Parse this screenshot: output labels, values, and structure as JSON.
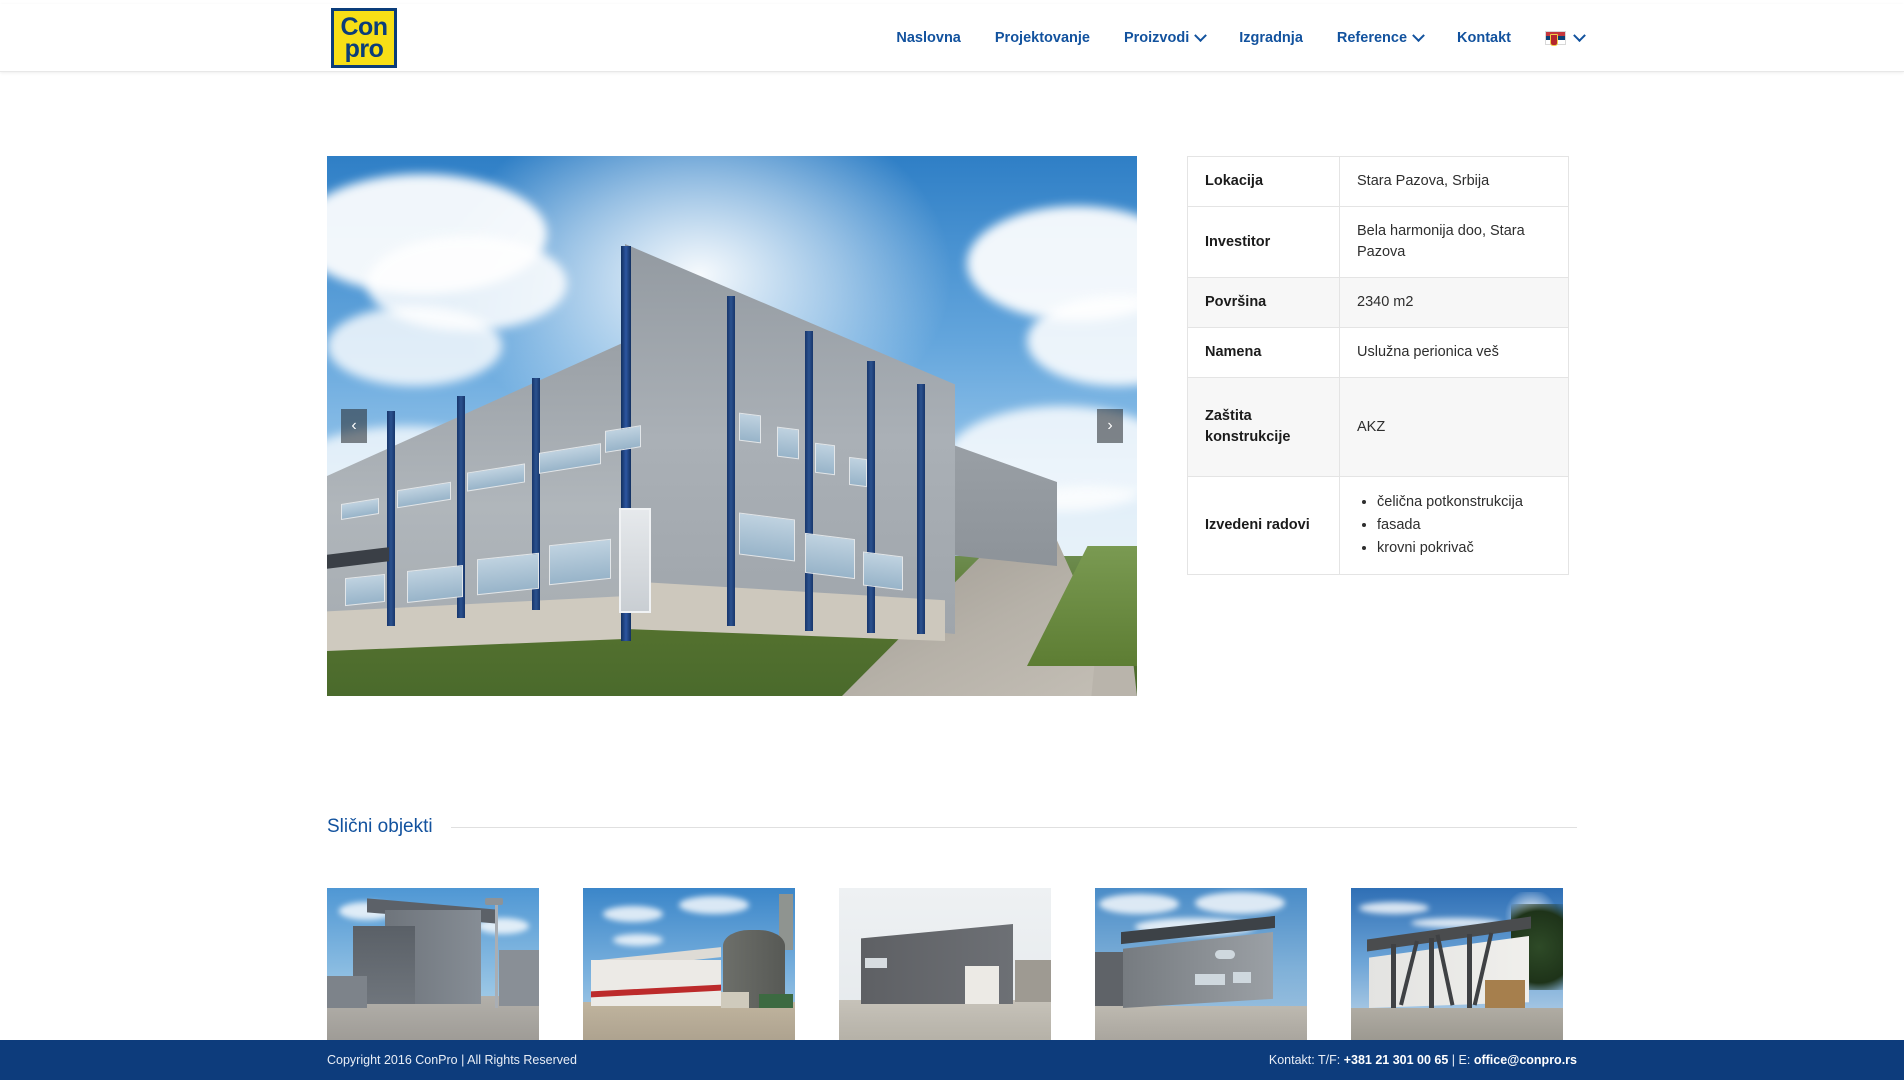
{
  "header": {
    "logo": {
      "line1": "Con",
      "line2": "pro",
      "bg_color": "#f7df16",
      "text_color": "#0b3d7a"
    },
    "nav": [
      {
        "label": "Naslovna",
        "has_dropdown": false
      },
      {
        "label": "Projektovanje",
        "has_dropdown": false
      },
      {
        "label": "Proizvodi",
        "has_dropdown": true
      },
      {
        "label": "Izgradnja",
        "has_dropdown": false
      },
      {
        "label": "Reference",
        "has_dropdown": true
      },
      {
        "label": "Kontakt",
        "has_dropdown": false
      }
    ],
    "language": {
      "flag": "serbia-flag-icon",
      "has_dropdown": true
    },
    "nav_color": "#12529e"
  },
  "carousel": {
    "prev_label": "‹",
    "next_label": "›",
    "image_alt": "Industrijski objekat - siva hala sa plavim stubovima"
  },
  "info_table": {
    "rows": [
      {
        "key": "Lokacija",
        "value": "Stara Pazova, Srbija",
        "type": "text"
      },
      {
        "key": "Investitor",
        "value": "Bela harmonija doo, Stara Pazova",
        "type": "text"
      },
      {
        "key": "Površina",
        "value": "2340 m2",
        "type": "text"
      },
      {
        "key": "Namena",
        "value": "Uslužna perionica veš",
        "type": "text"
      },
      {
        "key": "Zaštita konstrukcije",
        "value": "AKZ",
        "type": "text"
      },
      {
        "key": "Izvedeni radovi",
        "type": "list",
        "items": [
          "čelična potkonstrukcija",
          "fasada",
          "krovni pokrivač"
        ]
      }
    ]
  },
  "similar": {
    "title": "Slični objekti",
    "thumbnails": [
      {
        "alt": "Otvorena nadstrešnica sa sivom oblogom"
      },
      {
        "alt": "Bela hala sa crvenom trakom i silosom"
      },
      {
        "alt": "Tamno siva hala sa belim rolo vratima"
      },
      {
        "alt": "Siva hala sa metalnom fasadom"
      },
      {
        "alt": "Bela hala sa čeličnim dijagonalama"
      }
    ]
  },
  "footer": {
    "copyright": "Copyright 2016 ConPro | All Rights Reserved",
    "contact_prefix": "Kontakt: T/F: ",
    "phone": "+381 21 301 00 65",
    "separator": " | E: ",
    "email": "office@conpro.rs",
    "bg_color": "#0d3c7c"
  }
}
